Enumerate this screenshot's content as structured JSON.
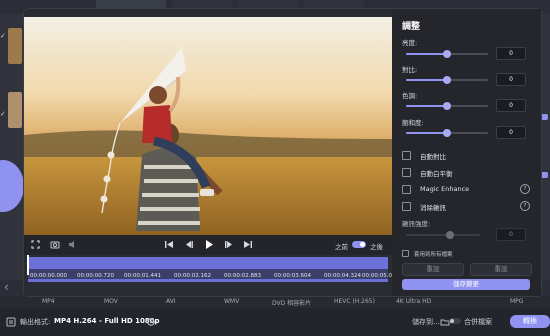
{
  "adjust_panel": {
    "title": "調整",
    "brightness": {
      "label": "亮度:",
      "value": "0",
      "level": 0.5
    },
    "contrast": {
      "label": "對比:",
      "value": "0",
      "level": 0.5
    },
    "hue": {
      "label": "色調:",
      "value": "0",
      "level": 0.5
    },
    "saturation": {
      "label": "飽和度:",
      "value": "0",
      "level": 0.5
    },
    "auto_contrast": "自動對比",
    "auto_white_balance": "自動白平衡",
    "magic_enhance": "Magic Enhance",
    "denoise": "消除雜訊",
    "denoise_strength_label": "雜訊強度:",
    "denoise_strength_value": "0",
    "apply_all": "套用到所有檔案",
    "reset_left": "重設",
    "reset_right": "重設",
    "save_changes": "儲存變更",
    "help_glyph": "?"
  },
  "player": {
    "before_label": "之前",
    "after_label": "之後",
    "timeline_times": [
      "00:00:00.000",
      "00:00:00.720",
      "00:00:01.441",
      "00:00:02.162",
      "00:00:02.883",
      "00:00:03.604",
      "00:00:04.324",
      "00:00:05.000"
    ],
    "progress": 0.0
  },
  "formats": [
    "MP4",
    "MOV",
    "AVI",
    "WMV",
    "DVD 相容影片",
    "HEVC (H.265)",
    "4K Ultra HD",
    "MPG"
  ],
  "bottom": {
    "output_label": "輸出格式:",
    "output_value": "MP4 H.264 - Full HD 1080p",
    "save_to": "儲存到...",
    "merge_files": "合併檔案",
    "convert": "轉換"
  },
  "colors": {
    "accent": "#8f93ef",
    "panel": "#24262c"
  }
}
